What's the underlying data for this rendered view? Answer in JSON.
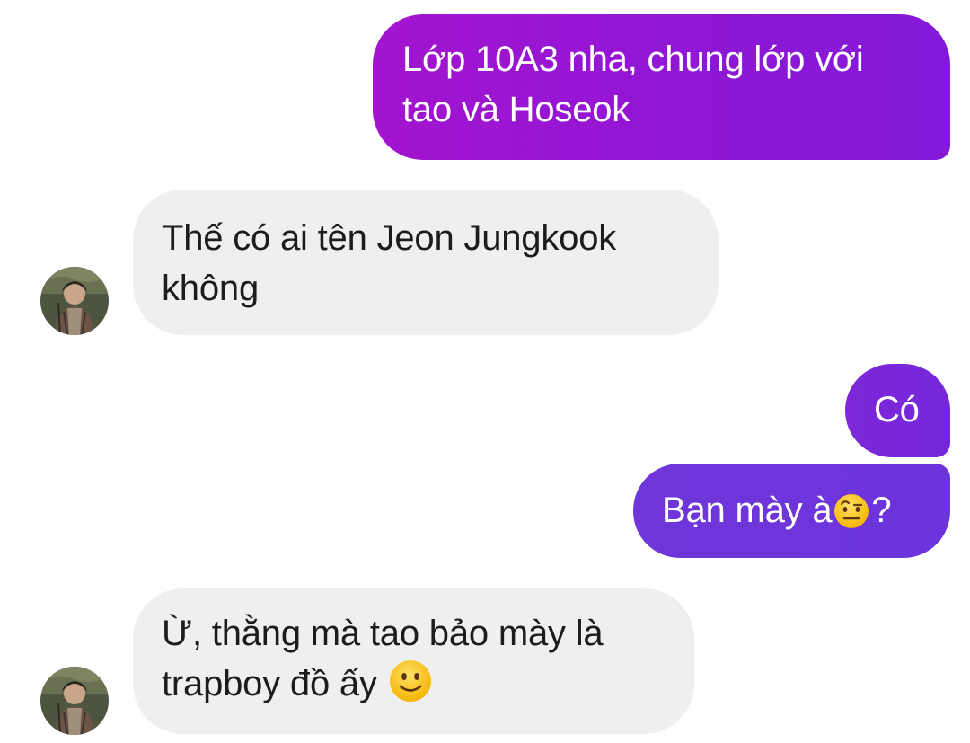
{
  "messages": [
    {
      "sender": "me",
      "lines": [
        "Lớp 10A3 nha, chung lớp với",
        "tao và Hoseok"
      ]
    },
    {
      "sender": "other",
      "lines": [
        "Thế có ai tên Jeon Jungkook",
        "không"
      ]
    },
    {
      "sender": "me",
      "text": "Có"
    },
    {
      "sender": "me",
      "text_before": "Bạn mày à",
      "emoji": "face-with-raised-eyebrow",
      "text_after": "?"
    },
    {
      "sender": "other",
      "lines": [
        "Ừ, thằng mà tao bảo mày là",
        "trapboy đồ ấy"
      ],
      "emoji": "slightly-smiling-face"
    }
  ],
  "colors": {
    "outgoing_top": "#a314cf",
    "outgoing_mid": "#7527db",
    "outgoing_bottom": "#6c34dc",
    "incoming_bg": "#efefef",
    "incoming_text": "#1c1c1e"
  },
  "avatar": {
    "icon": "contact-avatar-photo"
  }
}
